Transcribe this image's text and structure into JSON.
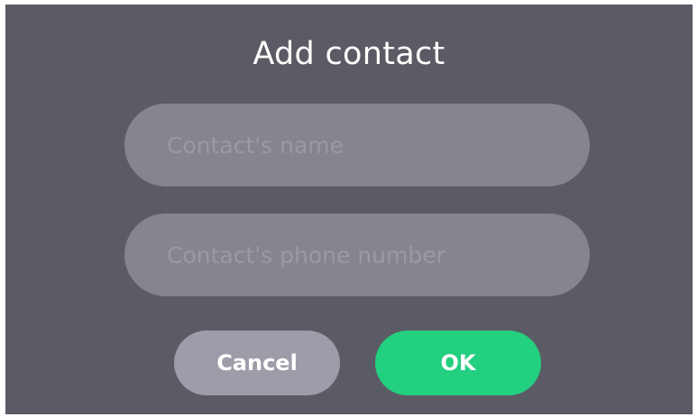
{
  "dialog": {
    "title": "Add contact",
    "fields": {
      "name": {
        "value": "",
        "placeholder": "Contact's name"
      },
      "phone": {
        "value": "",
        "placeholder": "Contact's phone number"
      }
    },
    "buttons": {
      "cancel_label": "Cancel",
      "ok_label": "OK"
    }
  },
  "colors": {
    "background": "#5b5b65",
    "field": "#858590",
    "cancel_button": "#9d9daa",
    "ok_button": "#22d07f"
  }
}
